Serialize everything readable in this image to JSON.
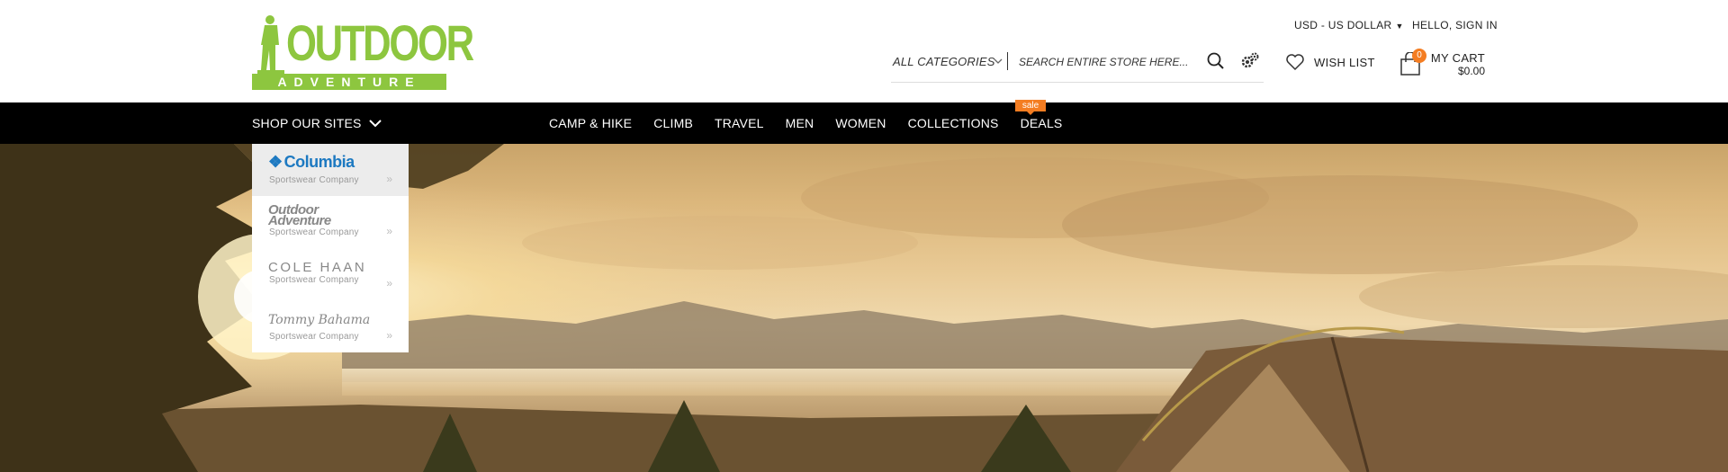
{
  "logo": {
    "word": "OUTDOOR",
    "sub": "ADVENTURE",
    "color": "#8dc63f"
  },
  "header": {
    "currency": "USD - US DOLLAR",
    "signin": "HELLO, SIGN IN",
    "search": {
      "category": "ALL CATEGORIES",
      "placeholder": "SEARCH ENTIRE STORE HERE..."
    },
    "wishlist": "WISH LIST",
    "cart": {
      "label": "MY CART",
      "count": "0",
      "total": "$0.00"
    }
  },
  "nav": {
    "shop_sites": "SHOP OUR SITES",
    "items": [
      "CAMP & HIKE",
      "CLIMB",
      "TRAVEL",
      "MEN",
      "WOMEN",
      "COLLECTIONS",
      "DEALS"
    ],
    "sale_badge": "sale",
    "accent": "#f47d22"
  },
  "dropdown": {
    "sites": [
      {
        "brand": "Columbia",
        "tagline": "Sportswear Company"
      },
      {
        "brand_line1": "utdoor",
        "brand_line2": "dventure",
        "tagline": "Sportswear Company"
      },
      {
        "brand": "COLE HAAN",
        "tagline": "Sportswear Company"
      },
      {
        "brand": "Tommy Bahama",
        "tagline": "Sportswear Company"
      }
    ]
  }
}
